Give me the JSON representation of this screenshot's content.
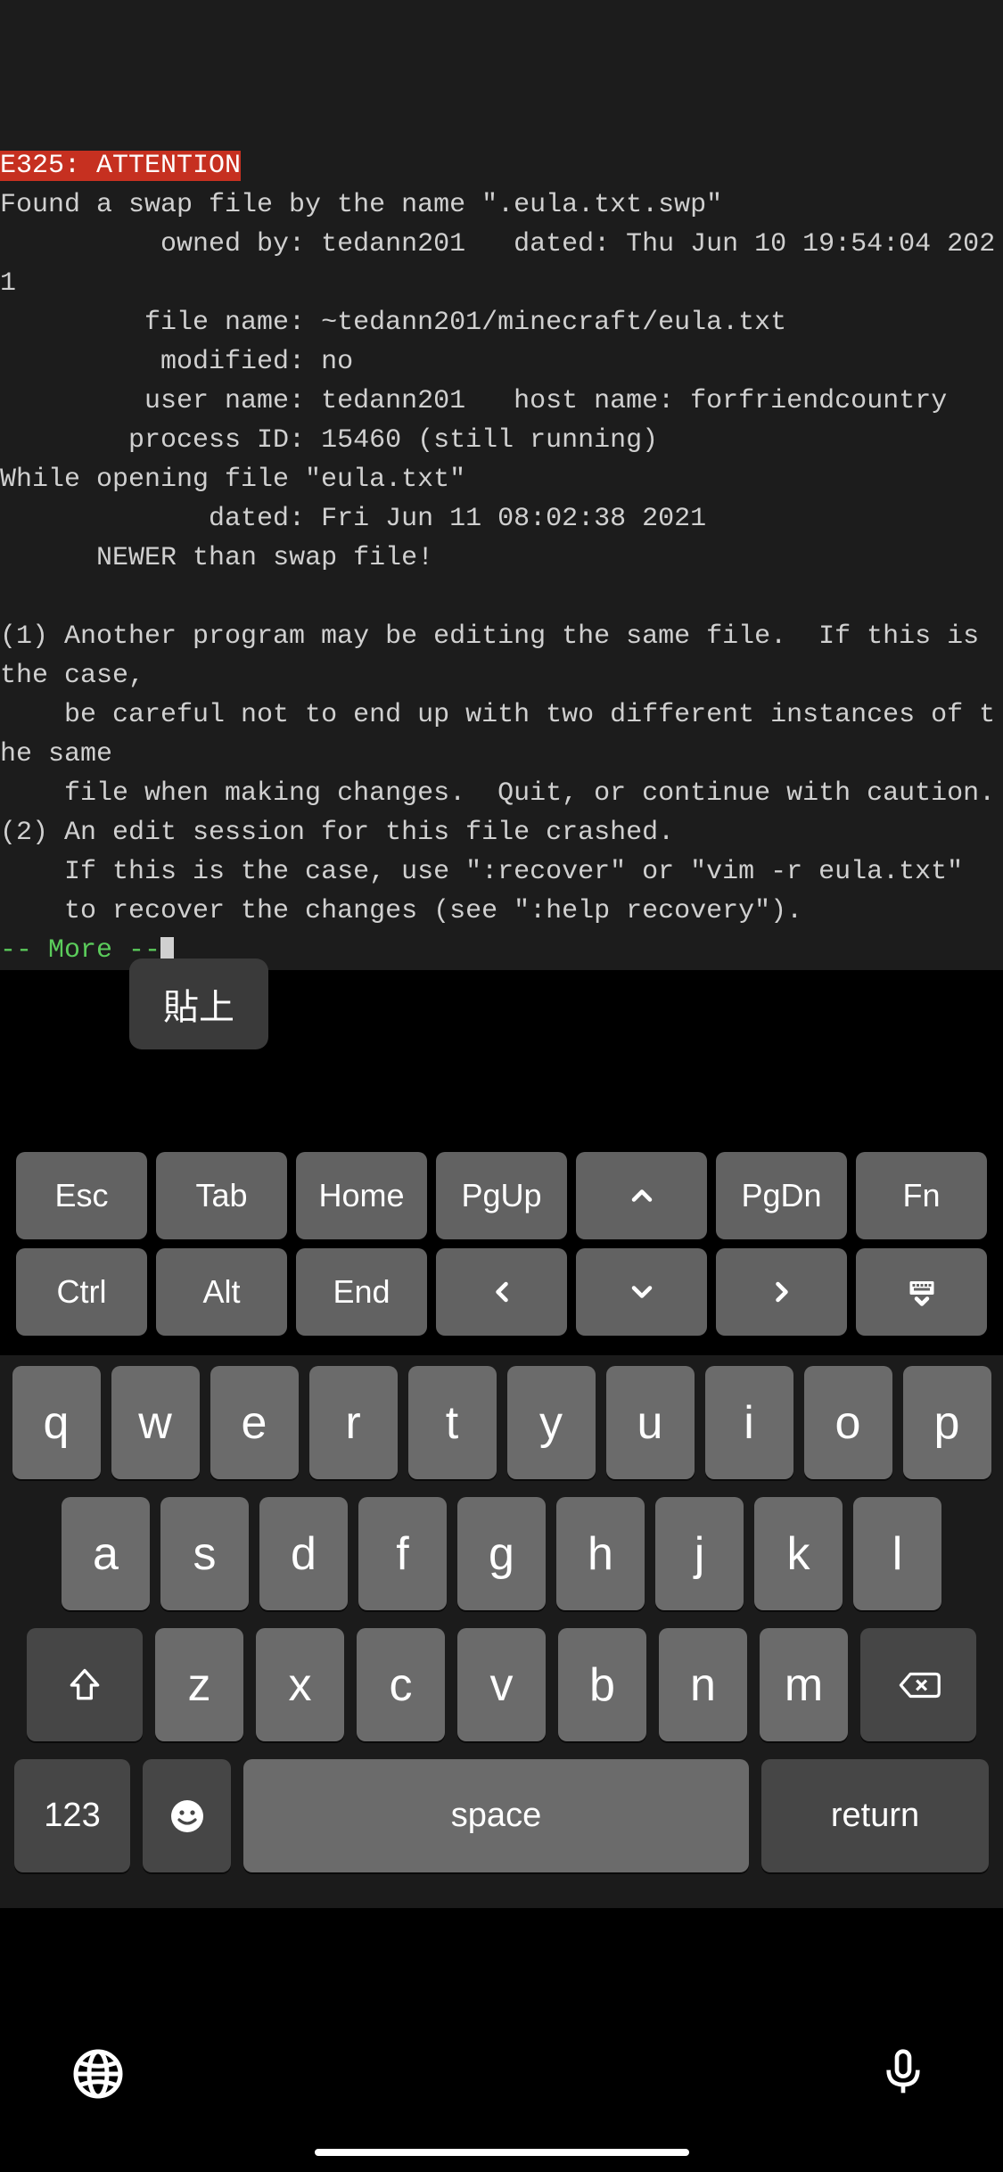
{
  "terminal": {
    "error_code": "E325: ATTENTION",
    "line_found": "Found a swap file by the name \".eula.txt.swp\"",
    "owned_by_label": "          owned by: ",
    "owned_by_value": "tedann201",
    "dated_label": "   dated: ",
    "dated_value": "Thu Jun 10 19:54:04 2021",
    "file_name_label": "         file name: ",
    "file_name_value": "~tedann201/minecraft/eula.txt",
    "modified_label": "          modified: ",
    "modified_value": "no",
    "user_name_label": "         user name: ",
    "user_name_value": "tedann201",
    "host_name_label": "   host name: ",
    "host_name_value": "forfriendcountry",
    "process_id_label": "        process ID: ",
    "process_id_value": "15460 (still running)",
    "while_opening": "While opening file \"eula.txt\"",
    "while_dated_label": "             dated: ",
    "while_dated_value": "Fri Jun 11 08:02:38 2021",
    "newer": "      NEWER than swap file!",
    "opt1_a": "(1) Another program may be editing the same file.  If this is the case,",
    "opt1_b": "    be careful not to end up with two different instances of the same",
    "opt1_c": "    file when making changes.  Quit, or continue with caution.",
    "opt2_a": "(2) An edit session for this file crashed.",
    "opt2_b": "    If this is the case, use \":recover\" or \"vim -r eula.txt\"",
    "opt2_c": "    to recover the changes (see \":help recovery\").",
    "more": "-- More --"
  },
  "popup": {
    "paste": "貼上"
  },
  "fn": {
    "esc": "Esc",
    "tab": "Tab",
    "home": "Home",
    "pgup": "PgUp",
    "up": "^",
    "pgdn": "PgDn",
    "fn": "Fn",
    "ctrl": "Ctrl",
    "alt": "Alt",
    "end": "End",
    "left": "<",
    "down": "v",
    "right": ">",
    "hide": "kb"
  },
  "kb": {
    "row1": [
      "q",
      "w",
      "e",
      "r",
      "t",
      "y",
      "u",
      "i",
      "o",
      "p"
    ],
    "row2": [
      "a",
      "s",
      "d",
      "f",
      "g",
      "h",
      "j",
      "k",
      "l"
    ],
    "row3": [
      "z",
      "x",
      "c",
      "v",
      "b",
      "n",
      "m"
    ],
    "num": "123",
    "space": "space",
    "return": "return"
  }
}
